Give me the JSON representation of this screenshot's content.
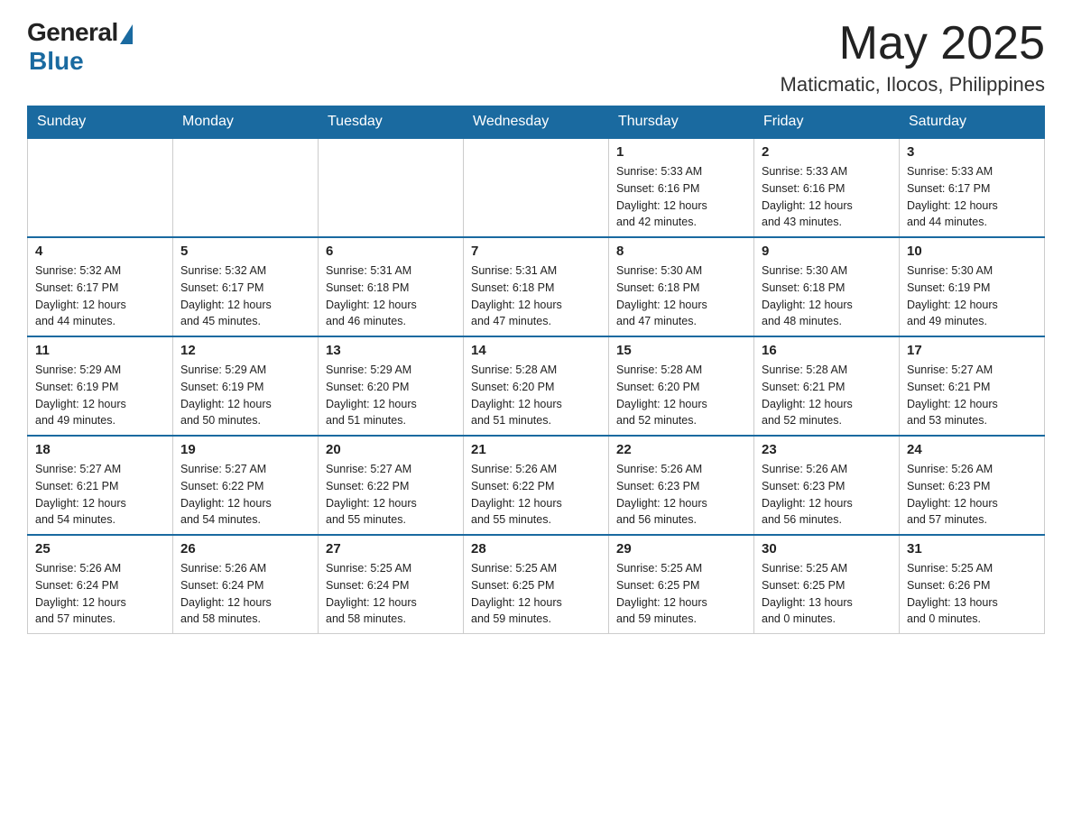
{
  "logo": {
    "general": "General",
    "blue": "Blue"
  },
  "title": "May 2025",
  "subtitle": "Maticmatic, Ilocos, Philippines",
  "days": [
    "Sunday",
    "Monday",
    "Tuesday",
    "Wednesday",
    "Thursday",
    "Friday",
    "Saturday"
  ],
  "weeks": [
    [
      {
        "num": "",
        "info": ""
      },
      {
        "num": "",
        "info": ""
      },
      {
        "num": "",
        "info": ""
      },
      {
        "num": "",
        "info": ""
      },
      {
        "num": "1",
        "info": "Sunrise: 5:33 AM\nSunset: 6:16 PM\nDaylight: 12 hours\nand 42 minutes."
      },
      {
        "num": "2",
        "info": "Sunrise: 5:33 AM\nSunset: 6:16 PM\nDaylight: 12 hours\nand 43 minutes."
      },
      {
        "num": "3",
        "info": "Sunrise: 5:33 AM\nSunset: 6:17 PM\nDaylight: 12 hours\nand 44 minutes."
      }
    ],
    [
      {
        "num": "4",
        "info": "Sunrise: 5:32 AM\nSunset: 6:17 PM\nDaylight: 12 hours\nand 44 minutes."
      },
      {
        "num": "5",
        "info": "Sunrise: 5:32 AM\nSunset: 6:17 PM\nDaylight: 12 hours\nand 45 minutes."
      },
      {
        "num": "6",
        "info": "Sunrise: 5:31 AM\nSunset: 6:18 PM\nDaylight: 12 hours\nand 46 minutes."
      },
      {
        "num": "7",
        "info": "Sunrise: 5:31 AM\nSunset: 6:18 PM\nDaylight: 12 hours\nand 47 minutes."
      },
      {
        "num": "8",
        "info": "Sunrise: 5:30 AM\nSunset: 6:18 PM\nDaylight: 12 hours\nand 47 minutes."
      },
      {
        "num": "9",
        "info": "Sunrise: 5:30 AM\nSunset: 6:18 PM\nDaylight: 12 hours\nand 48 minutes."
      },
      {
        "num": "10",
        "info": "Sunrise: 5:30 AM\nSunset: 6:19 PM\nDaylight: 12 hours\nand 49 minutes."
      }
    ],
    [
      {
        "num": "11",
        "info": "Sunrise: 5:29 AM\nSunset: 6:19 PM\nDaylight: 12 hours\nand 49 minutes."
      },
      {
        "num": "12",
        "info": "Sunrise: 5:29 AM\nSunset: 6:19 PM\nDaylight: 12 hours\nand 50 minutes."
      },
      {
        "num": "13",
        "info": "Sunrise: 5:29 AM\nSunset: 6:20 PM\nDaylight: 12 hours\nand 51 minutes."
      },
      {
        "num": "14",
        "info": "Sunrise: 5:28 AM\nSunset: 6:20 PM\nDaylight: 12 hours\nand 51 minutes."
      },
      {
        "num": "15",
        "info": "Sunrise: 5:28 AM\nSunset: 6:20 PM\nDaylight: 12 hours\nand 52 minutes."
      },
      {
        "num": "16",
        "info": "Sunrise: 5:28 AM\nSunset: 6:21 PM\nDaylight: 12 hours\nand 52 minutes."
      },
      {
        "num": "17",
        "info": "Sunrise: 5:27 AM\nSunset: 6:21 PM\nDaylight: 12 hours\nand 53 minutes."
      }
    ],
    [
      {
        "num": "18",
        "info": "Sunrise: 5:27 AM\nSunset: 6:21 PM\nDaylight: 12 hours\nand 54 minutes."
      },
      {
        "num": "19",
        "info": "Sunrise: 5:27 AM\nSunset: 6:22 PM\nDaylight: 12 hours\nand 54 minutes."
      },
      {
        "num": "20",
        "info": "Sunrise: 5:27 AM\nSunset: 6:22 PM\nDaylight: 12 hours\nand 55 minutes."
      },
      {
        "num": "21",
        "info": "Sunrise: 5:26 AM\nSunset: 6:22 PM\nDaylight: 12 hours\nand 55 minutes."
      },
      {
        "num": "22",
        "info": "Sunrise: 5:26 AM\nSunset: 6:23 PM\nDaylight: 12 hours\nand 56 minutes."
      },
      {
        "num": "23",
        "info": "Sunrise: 5:26 AM\nSunset: 6:23 PM\nDaylight: 12 hours\nand 56 minutes."
      },
      {
        "num": "24",
        "info": "Sunrise: 5:26 AM\nSunset: 6:23 PM\nDaylight: 12 hours\nand 57 minutes."
      }
    ],
    [
      {
        "num": "25",
        "info": "Sunrise: 5:26 AM\nSunset: 6:24 PM\nDaylight: 12 hours\nand 57 minutes."
      },
      {
        "num": "26",
        "info": "Sunrise: 5:26 AM\nSunset: 6:24 PM\nDaylight: 12 hours\nand 58 minutes."
      },
      {
        "num": "27",
        "info": "Sunrise: 5:25 AM\nSunset: 6:24 PM\nDaylight: 12 hours\nand 58 minutes."
      },
      {
        "num": "28",
        "info": "Sunrise: 5:25 AM\nSunset: 6:25 PM\nDaylight: 12 hours\nand 59 minutes."
      },
      {
        "num": "29",
        "info": "Sunrise: 5:25 AM\nSunset: 6:25 PM\nDaylight: 12 hours\nand 59 minutes."
      },
      {
        "num": "30",
        "info": "Sunrise: 5:25 AM\nSunset: 6:25 PM\nDaylight: 13 hours\nand 0 minutes."
      },
      {
        "num": "31",
        "info": "Sunrise: 5:25 AM\nSunset: 6:26 PM\nDaylight: 13 hours\nand 0 minutes."
      }
    ]
  ]
}
